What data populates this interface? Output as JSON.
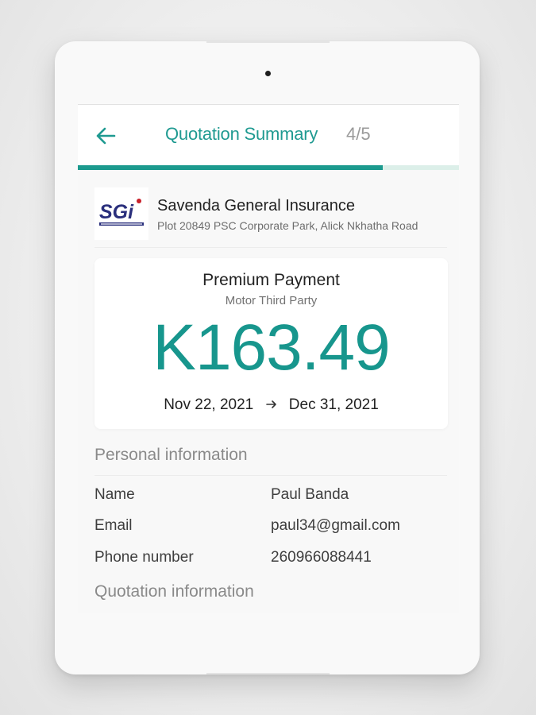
{
  "appbar": {
    "back_icon": "arrow-left-icon",
    "title": "Quotation Summary",
    "step": "4/5",
    "accent_color": "#1f9a91"
  },
  "progress": {
    "fraction": 0.8,
    "fill_color": "#1b9a8e",
    "track_color": "#dcefe9"
  },
  "company": {
    "logo_text": "SGI",
    "name": "Savenda General Insurance",
    "address": "Plot 20849 PSC Corporate Park, Alick Nkhatha Road"
  },
  "premium": {
    "title": "Premium Payment",
    "subtitle": "Motor Third Party",
    "amount": "K163.49",
    "start_date": "Nov 22, 2021",
    "end_date": "Dec 31, 2021",
    "arrow_icon": "arrow-right-icon"
  },
  "personal": {
    "heading": "Personal information",
    "rows": [
      {
        "label": "Name",
        "value": "Paul Banda"
      },
      {
        "label": "Email",
        "value": "paul34@gmail.com"
      },
      {
        "label": "Phone number",
        "value": "260966088441"
      }
    ]
  },
  "quotation": {
    "heading": "Quotation information"
  }
}
